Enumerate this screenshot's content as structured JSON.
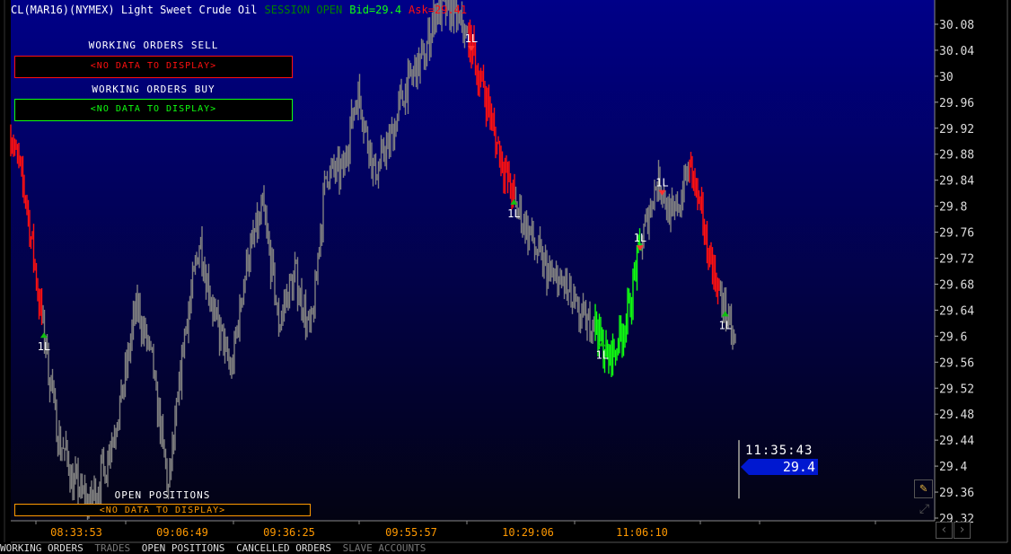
{
  "header": {
    "instrument": "CL(MAR16)(NYMEX) Light Sweet Crude Oil",
    "session": "SESSION OPEN",
    "bid": "Bid=29.4",
    "ask": "Ask=29.41"
  },
  "panels": {
    "sell_title": "WORKING ORDERS SELL",
    "sell_empty": "<NO DATA TO DISPLAY>",
    "buy_title": "WORKING ORDERS BUY",
    "buy_empty": "<NO DATA TO DISPLAY>",
    "positions_title": "OPEN POSITIONS",
    "positions_empty": "<NO DATA TO DISPLAY>"
  },
  "last": {
    "time": "11:35:43",
    "price": "29.4"
  },
  "tabs": [
    {
      "label": "WORKING ORDERS",
      "active": true
    },
    {
      "label": "TRADES",
      "active": false
    },
    {
      "label": "OPEN POSITIONS",
      "active": true
    },
    {
      "label": "CANCELLED ORDERS",
      "active": true
    },
    {
      "label": "SLAVE ACCOUNTS",
      "active": false
    }
  ],
  "colors": {
    "sell": "#ff1010",
    "buy": "#10ff10",
    "positions": "#ff9900",
    "bar": "#808080",
    "session": "#008000",
    "axis_time": "#ff9900"
  },
  "chart_data": {
    "type": "bar",
    "title": "CL(MAR16)(NYMEX) Light Sweet Crude Oil",
    "ylim": [
      29.32,
      30.1
    ],
    "y_ticks": [
      "30.08",
      "30.04",
      "30",
      "29.96",
      "29.92",
      "29.88",
      "29.84",
      "29.8",
      "29.76",
      "29.72",
      "29.68",
      "29.64",
      "29.6",
      "29.56",
      "29.52",
      "29.48",
      "29.44",
      "29.4",
      "29.36",
      "29.32"
    ],
    "x_ticks": [
      "08:33:53",
      "09:06:49",
      "09:36:25",
      "09:55:57",
      "10:29:06",
      "11:06:10"
    ],
    "prices": [
      29.92,
      29.8,
      29.62,
      29.45,
      29.38,
      29.34,
      29.4,
      29.5,
      29.65,
      29.55,
      29.36,
      29.6,
      29.75,
      29.62,
      29.55,
      29.72,
      29.8,
      29.62,
      29.7,
      29.6,
      29.85,
      29.85,
      29.98,
      29.85,
      29.9,
      29.98,
      30.02,
      30.1,
      30.1,
      30.06,
      29.98,
      29.88,
      29.8,
      29.75,
      29.7,
      29.68,
      29.63,
      29.62,
      29.56,
      29.62,
      29.75,
      29.84,
      29.78,
      29.86,
      29.76,
      29.66,
      29.58
    ],
    "segment_colors": {
      "red": [
        [
          0,
          2
        ],
        [
          29,
          32
        ],
        [
          43,
          45
        ]
      ],
      "green": [
        [
          37,
          40
        ]
      ]
    },
    "last_bar": 29.4,
    "fills": [
      {
        "label": "1L",
        "side": "sell",
        "index": 29.2
      },
      {
        "label": "1L",
        "side": "buy",
        "index": 31.9
      },
      {
        "label": "1L",
        "side": "buy",
        "index": 2.1
      },
      {
        "label": "1L",
        "side": "buy",
        "index": 37.5
      },
      {
        "label": "1L",
        "side": "sell",
        "index": 39.9
      },
      {
        "label": "1L",
        "side": "sell",
        "index": 41.3
      },
      {
        "label": "1L",
        "side": "buy",
        "index": 45.3
      }
    ]
  }
}
